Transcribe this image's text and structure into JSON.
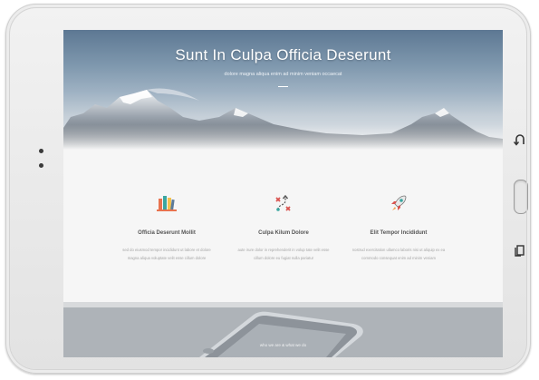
{
  "hero": {
    "title": "Sunt In Culpa Officia Deserunt",
    "subtitle": "dolore magna aliqua enim ad minim veniam occaecat"
  },
  "features": [
    {
      "icon": "books-icon",
      "title": "Officia Deserunt Mollit",
      "text": "sed do eiusmod tempor incididunt ut labore et dolore magna aliqua voluptate velit esse cillum dolore"
    },
    {
      "icon": "strategy-icon",
      "title": "Culpa Kilum Dolore",
      "text": "aute irure dolor in reprehenderit in volup tate velit esse cillum dolore eu fugiat nulla pariatur"
    },
    {
      "icon": "rocket-icon",
      "title": "Elit Tempor Incididunt",
      "text": "nostrud exercitation ullamco laboris nisi ut aliquip ex ea commodo consequat enim ad minim veniam"
    }
  ],
  "footer": {
    "caption": "who we are & what we do"
  },
  "device": {
    "color": "#e9e9e9",
    "accent_colors": [
      "#e8734f",
      "#3aa6a0",
      "#f2c14e",
      "#d9534f"
    ]
  }
}
